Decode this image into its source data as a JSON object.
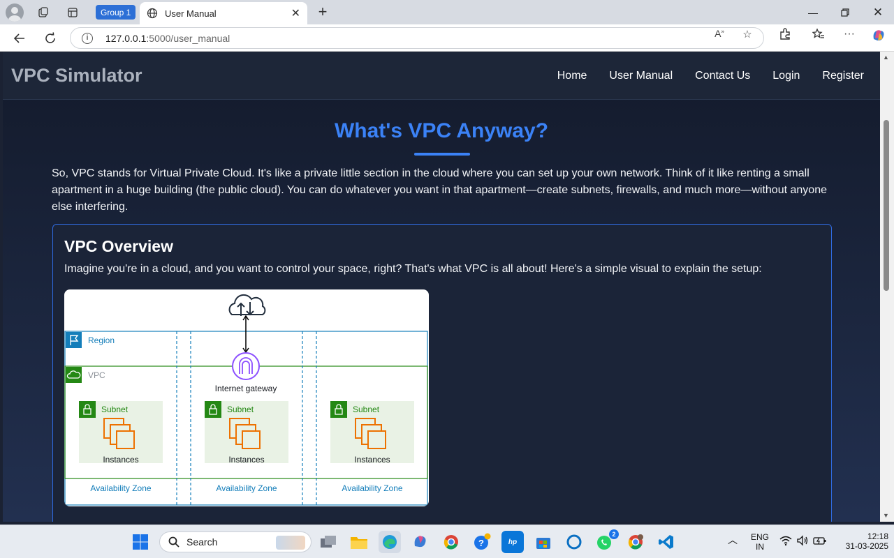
{
  "browser": {
    "group_label": "Group 1",
    "tab_title": "User Manual",
    "url_host": "127.0.0.1",
    "url_path": ":5000/user_manual"
  },
  "site": {
    "brand": "VPC Simulator",
    "nav": [
      "Home",
      "User Manual",
      "Contact Us",
      "Login",
      "Register"
    ]
  },
  "content": {
    "heading": "What's VPC Anyway?",
    "intro": "So, VPC stands for Virtual Private Cloud. It's like a private little section in the cloud where you can set up your own network. Think of it like renting a small apartment in a huge building (the public cloud). You can do whatever you want in that apartment—create subnets, firewalls, and much more—without anyone else interfering.",
    "card_title": "VPC Overview",
    "card_text": "Imagine you're in a cloud, and you want to control your space, right? That's what VPC is all about! Here's a simple visual to explain the setup:"
  },
  "diagram": {
    "region": "Region",
    "vpc": "VPC",
    "gateway": "Internet gateway",
    "subnet": "Subnet",
    "instances": "Instances",
    "az": "Availability Zone"
  },
  "taskbar": {
    "search": "Search",
    "lang_top": "ENG",
    "lang_bottom": "IN",
    "time": "12:18",
    "date": "31-03-2025",
    "whatsapp_badge": "2"
  },
  "colors": {
    "accent": "#3b82f6",
    "region_blue": "#147eba",
    "vpc_green": "#248814",
    "gateway_purple": "#8c4fff",
    "instance_orange": "#ed7100"
  }
}
